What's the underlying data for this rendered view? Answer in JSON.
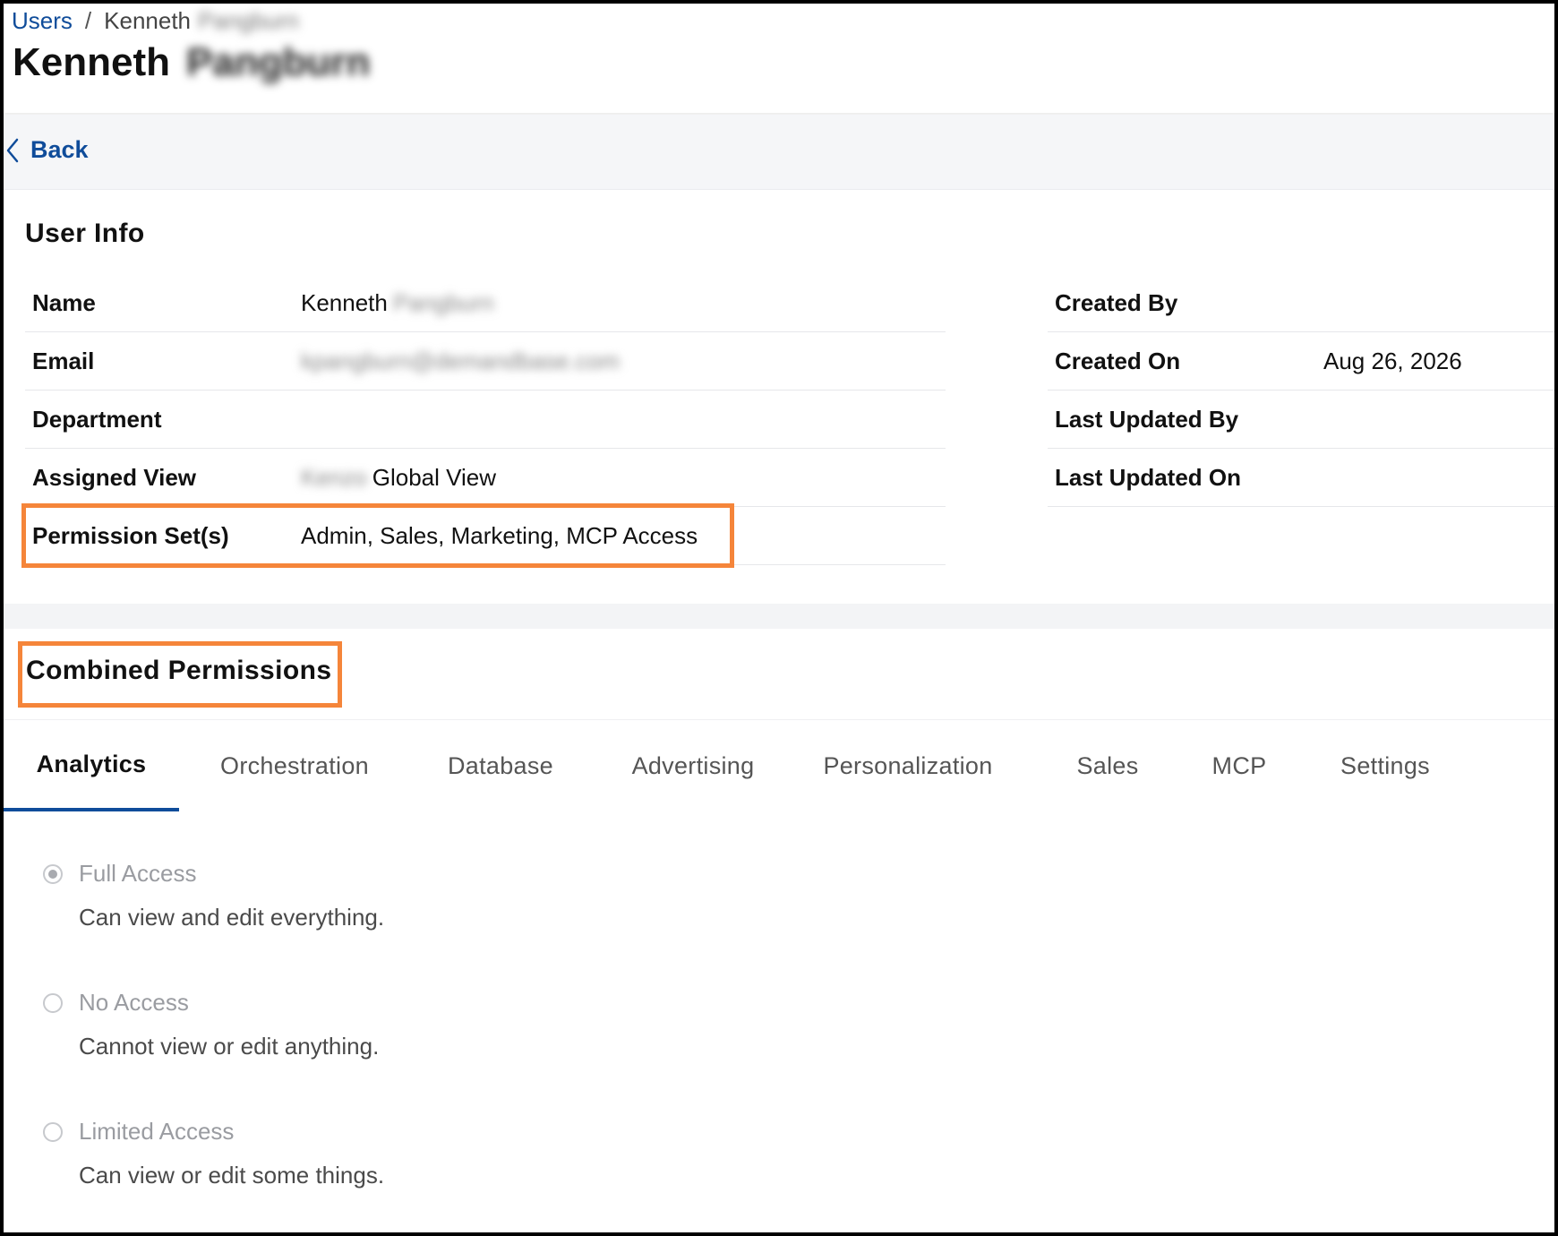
{
  "breadcrumb": {
    "root": "Users",
    "separator": "/",
    "current_first": "Kenneth",
    "current_last": "Pangburn"
  },
  "page": {
    "title_first": "Kenneth",
    "title_last": "Pangburn"
  },
  "back": {
    "label": "Back"
  },
  "user_info": {
    "title": "User Info",
    "left_rows": [
      {
        "label": "Name",
        "value": "Kenneth",
        "value_blurred": "Pangburn"
      },
      {
        "label": "Email",
        "value": "",
        "value_blurred": "kpangburn@demandbase.com"
      },
      {
        "label": "Department",
        "value": ""
      },
      {
        "label": "Assigned View",
        "value_blurred_prefix": "Kenzo",
        "value": "Global View"
      },
      {
        "label": "Permission Set(s)",
        "value": "Admin, Sales, Marketing, MCP Access"
      }
    ],
    "right_rows": [
      {
        "label": "Created By",
        "value": ""
      },
      {
        "label": "Created On",
        "value": "Aug 26, 2026"
      },
      {
        "label": "Last Updated By",
        "value": ""
      },
      {
        "label": "Last Updated On",
        "value": ""
      }
    ]
  },
  "combined_permissions": {
    "title": "Combined Permissions",
    "tabs": [
      {
        "label": "Analytics",
        "active": true
      },
      {
        "label": "Orchestration",
        "active": false
      },
      {
        "label": "Database",
        "active": false
      },
      {
        "label": "Advertising",
        "active": false
      },
      {
        "label": "Personalization",
        "active": false
      },
      {
        "label": "Sales",
        "active": false
      },
      {
        "label": "MCP",
        "active": false
      },
      {
        "label": "Settings",
        "active": false
      }
    ],
    "options": [
      {
        "label": "Full Access",
        "description": "Can view and edit everything.",
        "selected": true
      },
      {
        "label": "No Access",
        "description": "Cannot view or edit anything.",
        "selected": false
      },
      {
        "label": "Limited Access",
        "description": "Can view or edit some things.",
        "selected": false
      }
    ]
  },
  "colors": {
    "link": "#0f4c9a",
    "highlight": "#f5853a",
    "active_tab_underline": "#0f4c9a"
  }
}
